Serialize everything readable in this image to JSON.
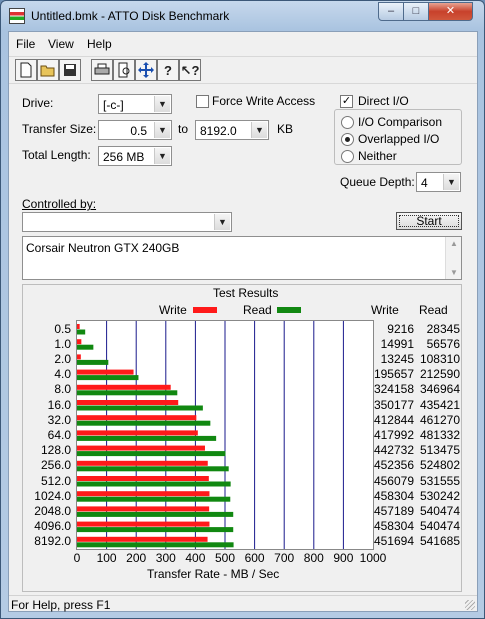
{
  "window": {
    "title": "Untitled.bmk - ATTO Disk Benchmark",
    "minimize": "–",
    "maximize": "□",
    "close": "✕"
  },
  "menu": [
    "File",
    "View",
    "Help"
  ],
  "toolbar": [
    "new-icon",
    "open-icon",
    "save-icon",
    "print-icon",
    "print-preview-icon",
    "move-icon",
    "help-icon",
    "context-help-icon"
  ],
  "form": {
    "drive_label": "Drive:",
    "drive_value": "[-c-]",
    "transfer_size_label": "Transfer Size:",
    "transfer_from": "0.5",
    "to_label": "to",
    "transfer_to": "8192.0",
    "unit": "KB",
    "total_length_label": "Total Length:",
    "total_length_value": "256 MB",
    "force_write_access_label": "Force Write Access",
    "force_write_access_checked": false,
    "direct_io_label": "Direct I/O",
    "direct_io_checked": true,
    "io_options": [
      {
        "label": "I/O Comparison",
        "selected": false
      },
      {
        "label": "Overlapped I/O",
        "selected": true
      },
      {
        "label": "Neither",
        "selected": false
      }
    ],
    "queue_depth_label": "Queue Depth:",
    "queue_depth_value": "4",
    "controlled_by_label": "Controlled by:",
    "controlled_by_value": "",
    "start_label": "Start",
    "description": "Corsair Neutron GTX 240GB"
  },
  "results": {
    "title": "Test Results",
    "write_legend": "Write",
    "read_legend": "Read",
    "write_col": "Write",
    "read_col": "Read",
    "rows": [
      {
        "size": "0.5",
        "write": "9216",
        "read": "28345"
      },
      {
        "size": "1.0",
        "write": "14991",
        "read": "56576"
      },
      {
        "size": "2.0",
        "write": "13245",
        "read": "108310"
      },
      {
        "size": "4.0",
        "write": "195657",
        "read": "212590"
      },
      {
        "size": "8.0",
        "write": "324158",
        "read": "346964"
      },
      {
        "size": "16.0",
        "write": "350177",
        "read": "435421"
      },
      {
        "size": "32.0",
        "write": "412844",
        "read": "461270"
      },
      {
        "size": "64.0",
        "write": "417992",
        "read": "481332"
      },
      {
        "size": "128.0",
        "write": "442732",
        "read": "513475"
      },
      {
        "size": "256.0",
        "write": "452356",
        "read": "524802"
      },
      {
        "size": "512.0",
        "write": "456079",
        "read": "531555"
      },
      {
        "size": "1024.0",
        "write": "458304",
        "read": "530242"
      },
      {
        "size": "2048.0",
        "write": "457189",
        "read": "540474"
      },
      {
        "size": "4096.0",
        "write": "458304",
        "read": "540474"
      },
      {
        "size": "8192.0",
        "write": "451694",
        "read": "541685"
      }
    ]
  },
  "chart_data": {
    "type": "bar",
    "orientation": "horizontal",
    "categories": [
      "0.5",
      "1.0",
      "2.0",
      "4.0",
      "8.0",
      "16.0",
      "32.0",
      "64.0",
      "128.0",
      "256.0",
      "512.0",
      "1024.0",
      "2048.0",
      "4096.0",
      "8192.0"
    ],
    "series": [
      {
        "name": "Write",
        "color": "#ff1a1a",
        "values": [
          9216,
          14991,
          13245,
          195657,
          324158,
          350177,
          412844,
          417992,
          442732,
          452356,
          456079,
          458304,
          457189,
          458304,
          451694
        ]
      },
      {
        "name": "Read",
        "color": "#118811",
        "values": [
          28345,
          56576,
          108310,
          212590,
          346964,
          435421,
          461270,
          481332,
          513475,
          524802,
          531555,
          530242,
          540474,
          540474,
          541685
        ]
      }
    ],
    "xlabel": "Transfer Rate - MB / Sec",
    "xlim": [
      0,
      1000
    ],
    "xticks": [
      "0",
      "100",
      "200",
      "300",
      "400",
      "500",
      "600",
      "700",
      "800",
      "900",
      "1000"
    ],
    "grid": true,
    "gridline_color": "#1a1a8c",
    "legend": "top"
  },
  "status": "For Help, press F1"
}
